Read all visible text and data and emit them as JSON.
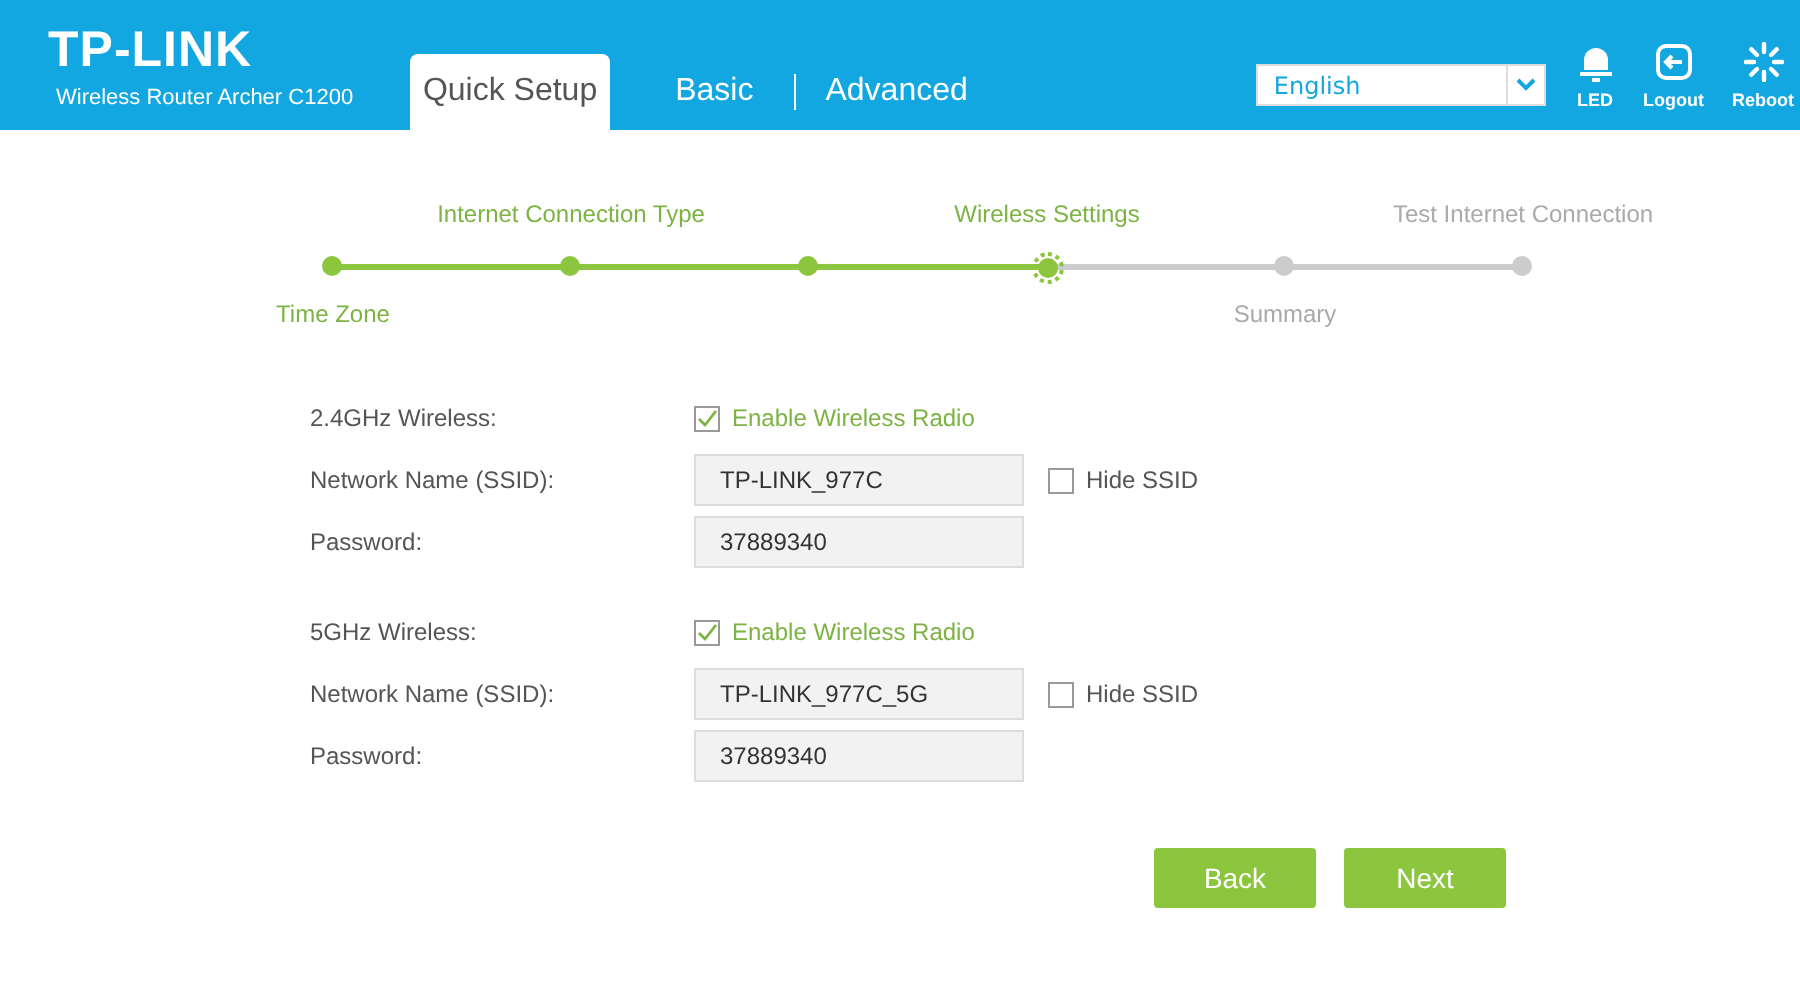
{
  "header": {
    "logo": "TP-LINK",
    "model": "Wireless Router Archer C1200",
    "tabs": [
      {
        "label": "Quick Setup",
        "selected": true
      },
      {
        "label": "Basic",
        "selected": false
      },
      {
        "label": "Advanced",
        "selected": false
      }
    ],
    "language": {
      "value": "English"
    },
    "tools": [
      {
        "kind": "led",
        "label": "LED"
      },
      {
        "kind": "logout",
        "label": "Logout"
      },
      {
        "kind": "reboot",
        "label": "Reboot"
      }
    ]
  },
  "steps": [
    {
      "label": "Time Zone",
      "above": false,
      "done": true,
      "current": false
    },
    {
      "label": "Internet Connection Type",
      "above": true,
      "done": true,
      "current": false
    },
    {
      "done": true,
      "current": false
    },
    {
      "label": "Wireless Settings",
      "above": true,
      "done": false,
      "current": true
    },
    {
      "label": "Summary",
      "above": false,
      "done": false,
      "current": false
    },
    {
      "label": "Test Internet Connection",
      "above": true,
      "done": false,
      "current": false
    }
  ],
  "sections": [
    {
      "rows": [
        {
          "kind": "checkbox",
          "label": "2.4GHz Wireless:",
          "option": "Enable Wireless Radio",
          "checked": true
        },
        {
          "kind": "text",
          "label": "Network Name (SSID):",
          "value": "TP-LINK_977C",
          "side": {
            "label": "Hide SSID",
            "checked": false
          }
        },
        {
          "kind": "text",
          "label": "Password:",
          "value": "37889340"
        }
      ]
    },
    {
      "rows": [
        {
          "kind": "checkbox",
          "label": "5GHz Wireless:",
          "option": "Enable Wireless Radio",
          "checked": true
        },
        {
          "kind": "text",
          "label": "Network Name (SSID):",
          "value": "TP-LINK_977C_5G",
          "side": {
            "label": "Hide SSID",
            "checked": false
          }
        },
        {
          "kind": "text",
          "label": "Password:",
          "value": "37889340"
        }
      ]
    }
  ],
  "buttons": [
    "Back",
    "Next"
  ]
}
